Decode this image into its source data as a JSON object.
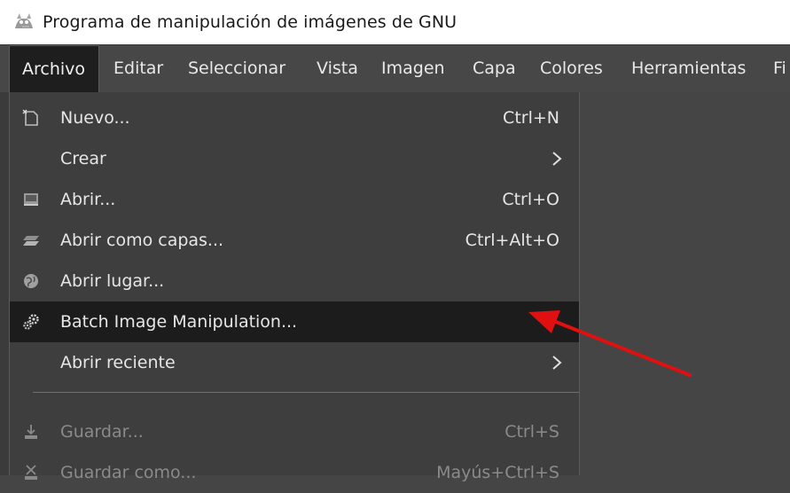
{
  "window": {
    "title": "Programa de manipulación de imágenes de GNU",
    "icon": "gimp-wilber-icon"
  },
  "menubar": {
    "items": [
      {
        "label": "Archivo",
        "active": true
      },
      {
        "label": "Editar"
      },
      {
        "label": "Seleccionar"
      },
      {
        "label": "Vista"
      },
      {
        "label": "Imagen"
      },
      {
        "label": "Capa"
      },
      {
        "label": "Colores"
      },
      {
        "label": "Herramientas"
      },
      {
        "label": "Fi"
      }
    ]
  },
  "file_menu": {
    "items": [
      {
        "label": "Nuevo...",
        "shortcut": "Ctrl+N",
        "icon": "new-document-icon"
      },
      {
        "label": "Crear",
        "submenu": true
      },
      {
        "label": "Abrir...",
        "shortcut": "Ctrl+O",
        "icon": "open-file-icon"
      },
      {
        "label": "Abrir como capas...",
        "shortcut": "Ctrl+Alt+O",
        "icon": "open-as-layers-icon"
      },
      {
        "label": "Abrir lugar...",
        "icon": "globe-icon"
      },
      {
        "label": "Batch Image Manipulation...",
        "icon": "gears-icon",
        "highlighted": true
      },
      {
        "label": "Abrir reciente",
        "submenu": true
      },
      {
        "label": "Guardar...",
        "shortcut": "Ctrl+S",
        "icon": "save-icon",
        "disabled": true
      },
      {
        "label": "Guardar como...",
        "shortcut": "Mayús+Ctrl+S",
        "icon": "save-as-icon",
        "disabled": true
      }
    ]
  },
  "colors": {
    "background": "#454545",
    "menu_bg": "#3e3e3e",
    "highlight_bg": "#1c1c1c",
    "annotation_arrow": "#e01010"
  }
}
